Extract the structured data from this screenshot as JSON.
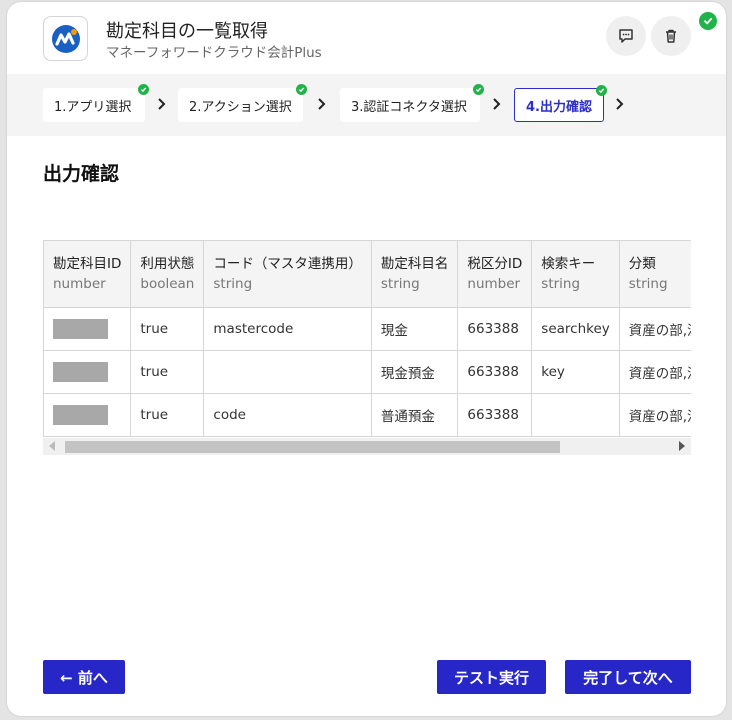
{
  "header": {
    "title": "勘定科目の一覧取得",
    "subtitle": "マネーフォワードクラウド会計Plus"
  },
  "steps": [
    {
      "label": "1.アプリ選択",
      "done": true
    },
    {
      "label": "2.アクション選択",
      "done": true
    },
    {
      "label": "3.認証コネクタ選択",
      "done": true
    },
    {
      "label": "4.出力確認",
      "done": true,
      "active": true
    }
  ],
  "section": {
    "title": "出力確認"
  },
  "table": {
    "columns": [
      {
        "name": "勘定科目ID",
        "type": "number"
      },
      {
        "name": "利用状態",
        "type": "boolean"
      },
      {
        "name": "コード（マスタ連携用）",
        "type": "string"
      },
      {
        "name": "勘定科目名",
        "type": "string"
      },
      {
        "name": "税区分ID",
        "type": "number"
      },
      {
        "name": "検索キー",
        "type": "string"
      },
      {
        "name": "分類",
        "type": "string"
      }
    ],
    "rows": [
      [
        "",
        "true",
        "mastercode",
        "現金",
        "663388",
        "searchkey",
        "資産の部,流"
      ],
      [
        "",
        "true",
        "",
        "現金預金",
        "663388",
        "key",
        "資産の部,流"
      ],
      [
        "",
        "true",
        "code",
        "普通預金",
        "663388",
        "",
        "資産の部,流"
      ]
    ]
  },
  "buttons": {
    "back": "← 前へ",
    "test": "テスト実行",
    "next": "完了して次へ"
  },
  "colors": {
    "accent": "#2727c8",
    "success": "#21b24a",
    "redacted": "#a8a8a8"
  }
}
